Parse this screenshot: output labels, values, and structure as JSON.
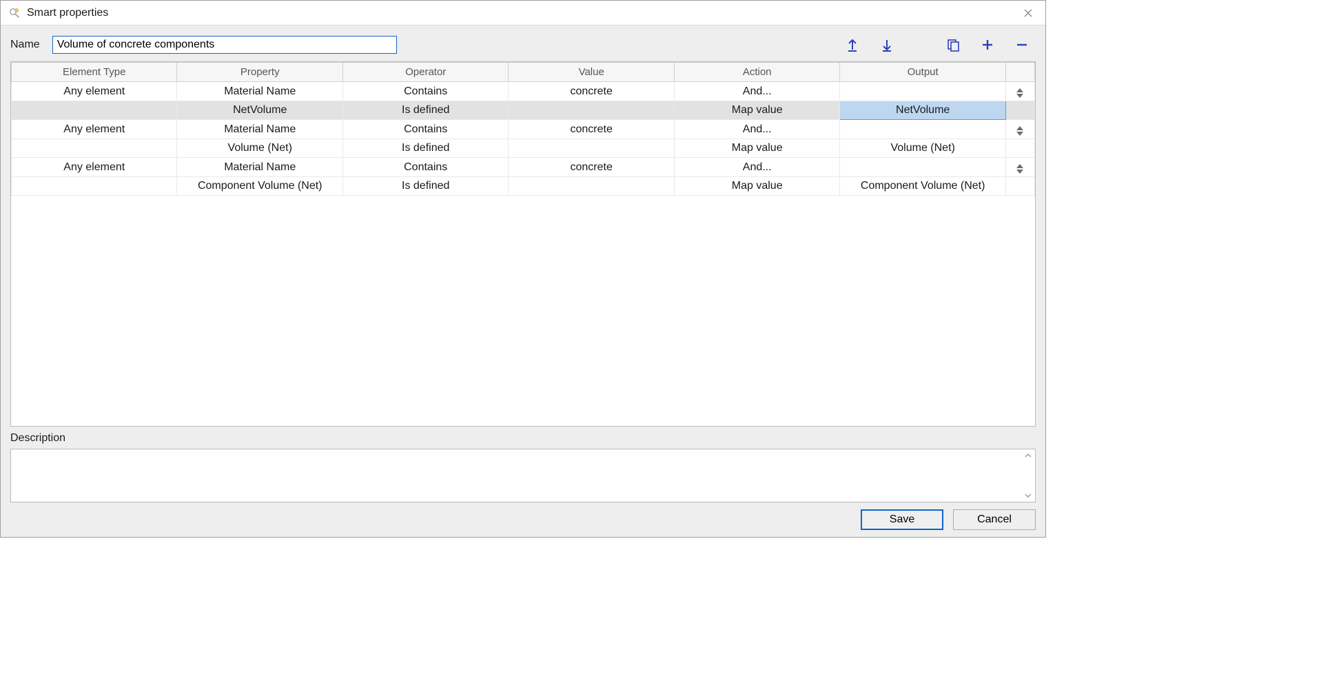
{
  "window": {
    "title": "Smart properties"
  },
  "form": {
    "name_label": "Name",
    "name_value": "Volume of concrete components",
    "description_label": "Description",
    "description_value": ""
  },
  "toolbar": {
    "move_up": "Move up",
    "move_down": "Move down",
    "duplicate": "Duplicate",
    "add": "Add",
    "remove": "Remove"
  },
  "grid": {
    "columns": [
      "Element Type",
      "Property",
      "Operator",
      "Value",
      "Action",
      "Output"
    ],
    "rows": [
      {
        "element_type": "Any element",
        "property": "Material Name",
        "operator": "Contains",
        "value": "concrete",
        "action": "And...",
        "output": "",
        "has_handle": true,
        "selected": false
      },
      {
        "element_type": "",
        "property": "NetVolume",
        "operator": "Is defined",
        "value": "",
        "action": "Map value",
        "output": "NetVolume",
        "has_handle": false,
        "selected": true
      },
      {
        "element_type": "Any element",
        "property": "Material Name",
        "operator": "Contains",
        "value": "concrete",
        "action": "And...",
        "output": "",
        "has_handle": true,
        "selected": false
      },
      {
        "element_type": "",
        "property": "Volume (Net)",
        "operator": "Is defined",
        "value": "",
        "action": "Map value",
        "output": "Volume (Net)",
        "has_handle": false,
        "selected": false
      },
      {
        "element_type": "Any element",
        "property": "Material Name",
        "operator": "Contains",
        "value": "concrete",
        "action": "And...",
        "output": "",
        "has_handle": true,
        "selected": false
      },
      {
        "element_type": "",
        "property": "Component Volume (Net)",
        "operator": "Is defined",
        "value": "",
        "action": "Map value",
        "output": "Component Volume (Net)",
        "has_handle": false,
        "selected": false
      }
    ]
  },
  "buttons": {
    "save": "Save",
    "cancel": "Cancel"
  }
}
